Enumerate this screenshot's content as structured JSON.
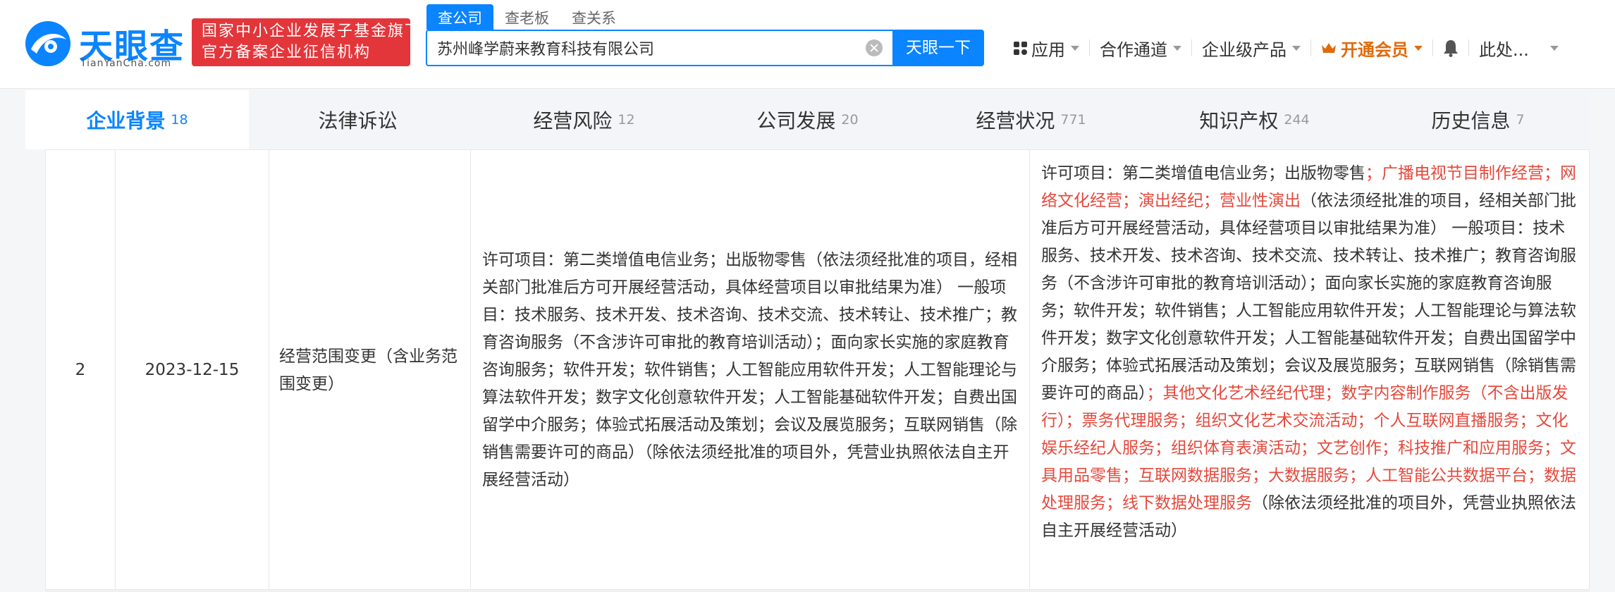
{
  "header": {
    "logo_text": "天眼查",
    "logo_sub": "TianYanCha.com",
    "badge_line1": "国家中小企业发展子基金旗下",
    "badge_line2": "官方备案企业征信机构",
    "search_tabs": [
      "查公司",
      "查老板",
      "查关系"
    ],
    "search_value": "苏州峰学蔚来教育科技有限公司",
    "search_button": "天眼一下",
    "nav": {
      "apps": "应用",
      "channel": "合作通道",
      "enterprise": "企业级产品",
      "vip": "开通会员",
      "user": "此处..."
    }
  },
  "tabs": [
    {
      "label": "企业背景",
      "count": "18"
    },
    {
      "label": "法律诉讼",
      "count": ""
    },
    {
      "label": "经营风险",
      "count": "12"
    },
    {
      "label": "公司发展",
      "count": "20"
    },
    {
      "label": "经营状况",
      "count": "771"
    },
    {
      "label": "知识产权",
      "count": "244"
    },
    {
      "label": "历史信息",
      "count": "7"
    }
  ],
  "record": {
    "index": "2",
    "date": "2023-12-15",
    "type": "经营范围变更（含业务范围变更）",
    "before": "许可项目：第二类增值电信业务；出版物零售（依法须经批准的项目，经相关部门批准后方可开展经营活动，具体经营项目以审批结果为准） 一般项目：技术服务、技术开发、技术咨询、技术交流、技术转让、技术推广；教育咨询服务（不含涉许可审批的教育培训活动）；面向家长实施的家庭教育咨询服务；软件开发；软件销售；人工智能应用软件开发；人工智能理论与算法软件开发；数字文化创意软件开发；人工智能基础软件开发；自费出国留学中介服务；体验式拓展活动及策划；会议及展览服务；互联网销售（除销售需要许可的商品）（除依法须经批准的项目外，凭营业执照依法自主开展经营活动）",
    "after_parts": [
      {
        "text": "许可项目：第二类增值电信业务；出版物零售",
        "highlight": false
      },
      {
        "text": "；广播电视节目制作经营；网络文化经营；演出经纪；营业性演出",
        "highlight": true
      },
      {
        "text": "（依法须经批准的项目，经相关部门批准后方可开展经营活动，具体经营项目以审批结果为准） 一般项目：技术服务、技术开发、技术咨询、技术交流、技术转让、技术推广；教育咨询服务（不含涉许可审批的教育培训活动）；面向家长实施的家庭教育咨询服务；软件开发；软件销售；人工智能应用软件开发；人工智能理论与算法软件开发；数字文化创意软件开发；人工智能基础软件开发；自费出国留学中介服务；体验式拓展活动及策划；会议及展览服务；互联网销售（除销售需要许可的商品）",
        "highlight": false
      },
      {
        "text": "；其他文化艺术经纪代理；数字内容制作服务（不含出版发行）；票务代理服务；组织文化艺术交流活动；个人互联网直播服务；文化娱乐经纪人服务；组织体育表演活动；文艺创作；科技推广和应用服务；文具用品零售；互联网数据服务；大数据服务；人工智能公共数据平台；数据处理服务；线下数据处理服务",
        "highlight": true
      },
      {
        "text": "（除依法须经批准的项目外，凭营业执照依法自主开展经营活动）",
        "highlight": false
      }
    ]
  },
  "colors": {
    "accent": "#0a84ff",
    "badge": "#e3363b",
    "highlight": "#e5483b",
    "vip": "#e06a0b"
  }
}
